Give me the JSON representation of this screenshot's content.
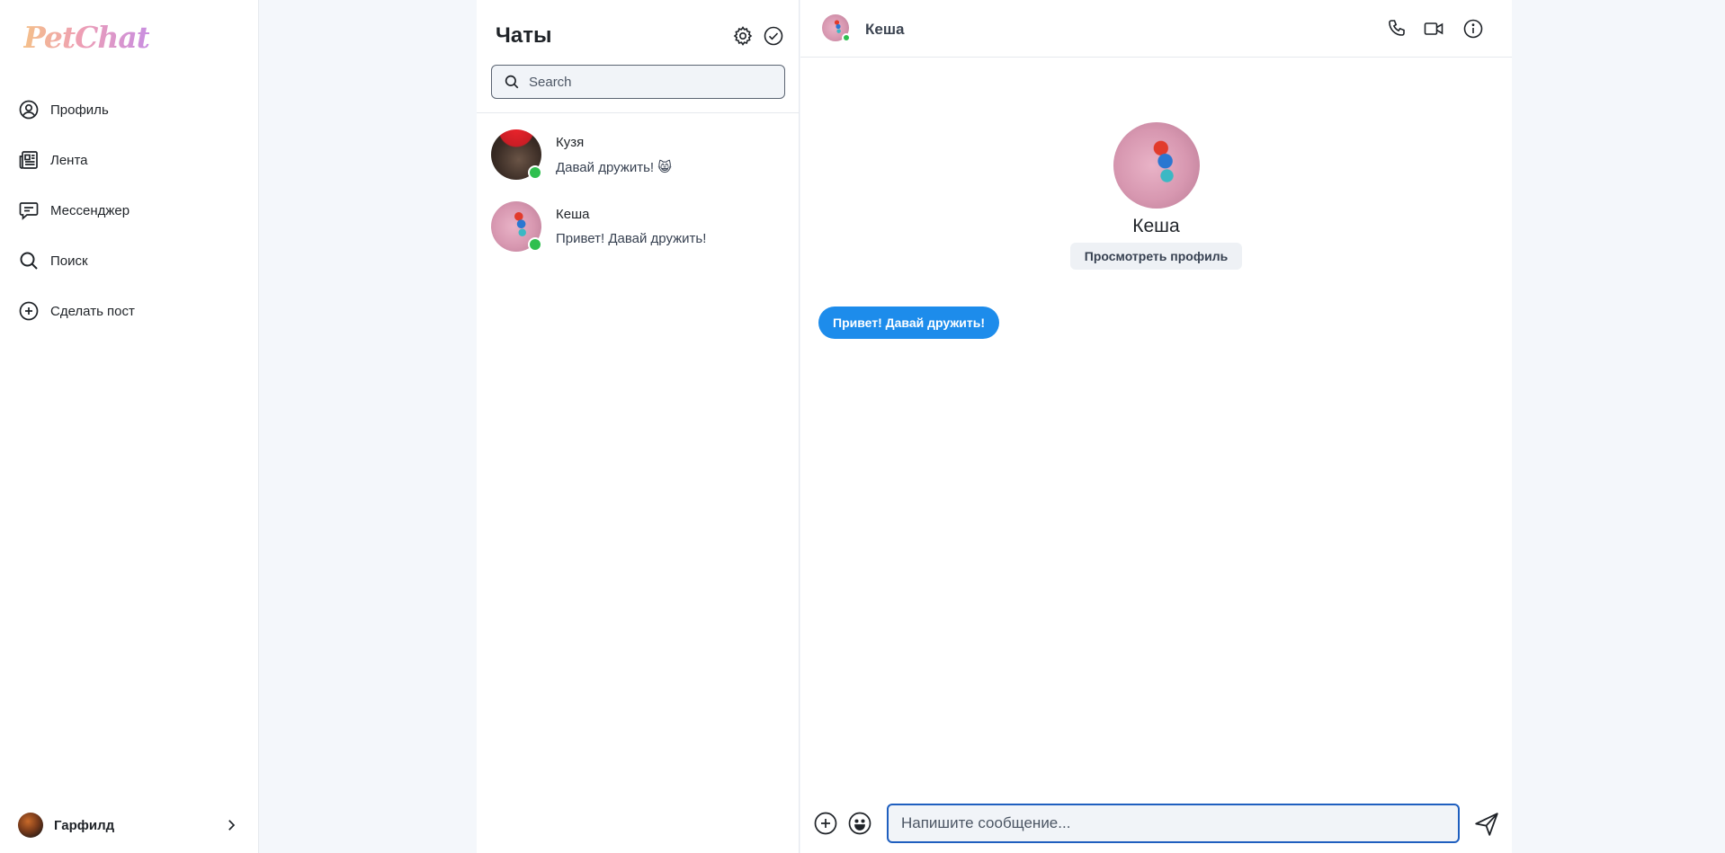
{
  "app": {
    "logo_text": "PetChat",
    "accent_color": "#1d8ceb",
    "online_color": "#2fbf4f"
  },
  "sidebar": {
    "items": [
      {
        "label": "Профиль",
        "icon": "user-circle-icon"
      },
      {
        "label": "Лента",
        "icon": "newspaper-icon"
      },
      {
        "label": "Мессенджер",
        "icon": "message-icon"
      },
      {
        "label": "Поиск",
        "icon": "search-icon"
      },
      {
        "label": "Сделать пост",
        "icon": "plus-circle-icon"
      }
    ],
    "user": {
      "name": "Гарфилд",
      "icon": "chevron-right-icon"
    }
  },
  "chat_list": {
    "title": "Чаты",
    "settings_icon": "gear-icon",
    "mark_read_icon": "check-circle-icon",
    "search": {
      "placeholder": "Search",
      "value": ""
    },
    "chats": [
      {
        "name": "Кузя",
        "preview": "Давай дружить! 😸",
        "online": true
      },
      {
        "name": "Кеша",
        "preview": "Привет! Давай дружить!",
        "online": true
      }
    ]
  },
  "conversation": {
    "contact_name": "Кеша",
    "actions": [
      "phone-icon",
      "video-icon",
      "info-icon"
    ],
    "profile": {
      "name": "Кеша",
      "view_profile_label": "Просмотреть профиль"
    },
    "messages": [
      {
        "text": "Привет! Давай дружить!",
        "outgoing": false
      }
    ],
    "composer": {
      "placeholder": "Напишите сообщение...",
      "value": "",
      "attach_icon": "plus-circle-icon",
      "emoji_icon": "emoji-icon",
      "send_icon": "send-icon"
    }
  }
}
